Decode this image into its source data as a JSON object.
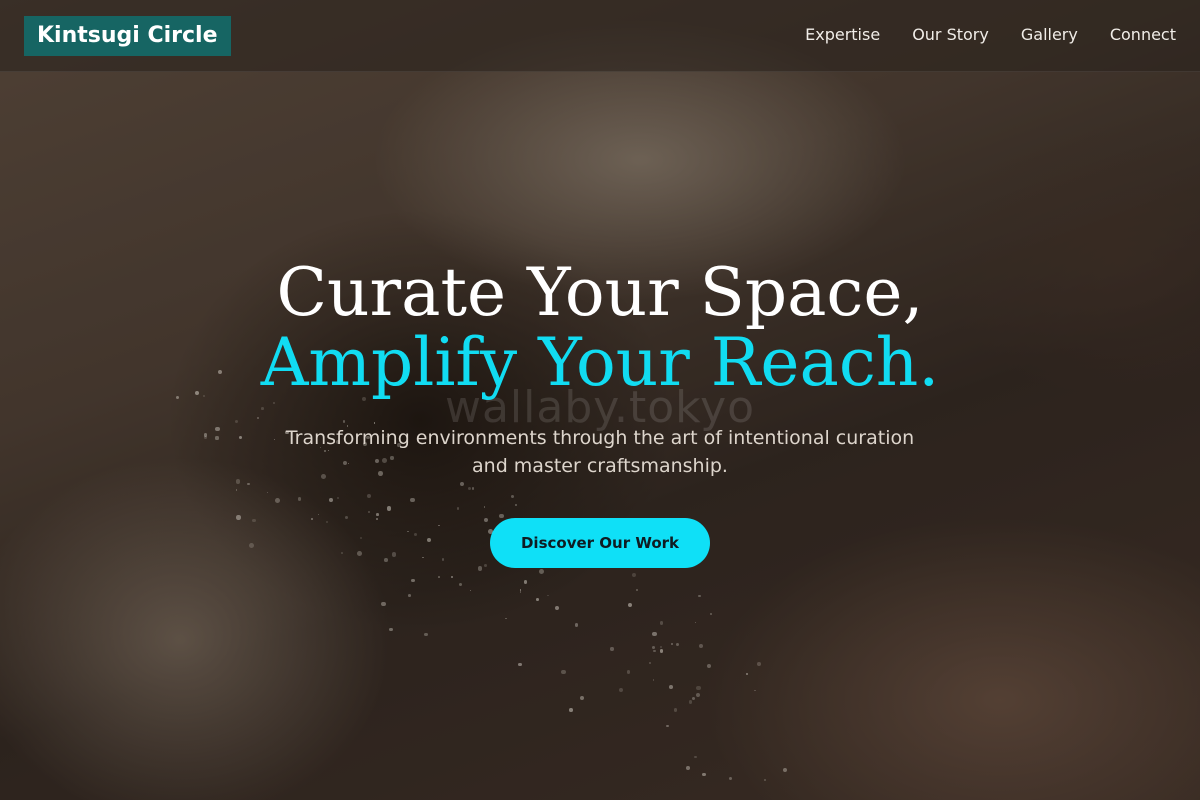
{
  "brand": {
    "name": "Kintsugi Circle"
  },
  "nav": {
    "items": [
      {
        "label": "Expertise"
      },
      {
        "label": "Our Story"
      },
      {
        "label": "Gallery"
      },
      {
        "label": "Connect"
      }
    ]
  },
  "hero": {
    "headline_line1": "Curate Your Space,",
    "headline_line2": "Amplify Your Reach.",
    "subtitle_line1": "Transforming environments through the art of intentional curation",
    "subtitle_line2": "and master craftsmanship.",
    "cta_label": "Discover Our Work",
    "watermark": "wallaby.tokyo"
  },
  "colors": {
    "brand_bg": "#166563",
    "accent": "#11dcf2",
    "cta_bg": "#0fe0f7",
    "text_light": "#ffffff"
  }
}
